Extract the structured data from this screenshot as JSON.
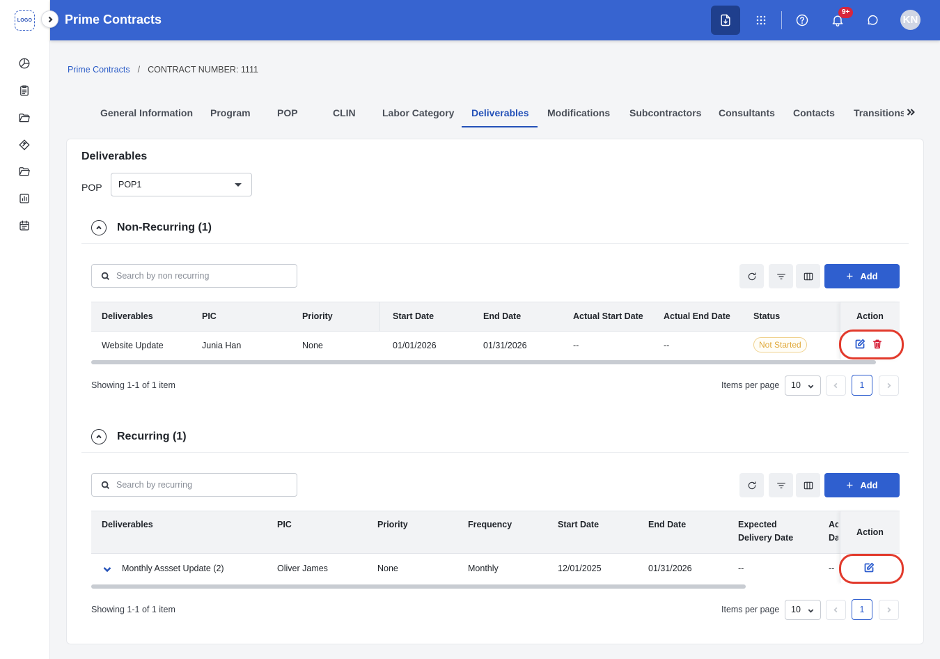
{
  "app": {
    "logo_text": "LOGO",
    "title": "Prime Contracts",
    "notifications_badge": "9+",
    "user_initials": "KN"
  },
  "breadcrumb": {
    "root": "Prime Contracts",
    "separator": "/",
    "current": "CONTRACT NUMBER: 1111"
  },
  "tabs": [
    {
      "label": "General Information"
    },
    {
      "label": "Program"
    },
    {
      "label": "POP"
    },
    {
      "label": "CLIN"
    },
    {
      "label": "Labor Category"
    },
    {
      "label": "Deliverables",
      "active": true
    },
    {
      "label": "Modifications"
    },
    {
      "label": "Subcontractors"
    },
    {
      "label": "Consultants"
    },
    {
      "label": "Contacts"
    },
    {
      "label": "Transitions"
    }
  ],
  "page": {
    "title": "Deliverables",
    "pop_label": "POP",
    "pop_value": "POP1"
  },
  "non_recurring": {
    "title": "Non-Recurring (1)",
    "search_placeholder": "Search by non recurring",
    "add_label": "Add",
    "columns": [
      "Deliverables",
      "PIC",
      "Priority",
      "Start Date",
      "End Date",
      "Actual Start Date",
      "Actual End Date",
      "Status",
      "Action"
    ],
    "rows": [
      {
        "deliverable": "Website Update",
        "pic": "Junia Han",
        "priority": "None",
        "start": "01/01/2026",
        "end": "01/31/2026",
        "actual_start": "--",
        "actual_end": "--",
        "status": "Not Started"
      }
    ],
    "showing": "Showing 1-1 of 1 item",
    "items_per_page_label": "Items per page",
    "items_per_page": "10",
    "page": "1"
  },
  "recurring": {
    "title": "Recurring (1)",
    "search_placeholder": "Search by recurring",
    "add_label": "Add",
    "columns": [
      "Deliverables",
      "PIC",
      "Priority",
      "Frequency",
      "Start Date",
      "End Date",
      "Expected Delivery Date",
      "Ac Da",
      "Action"
    ],
    "rows": [
      {
        "deliverable": "Monthly Assset Update (2)",
        "pic": "Oliver James",
        "priority": "None",
        "frequency": "Monthly",
        "start": "12/01/2025",
        "end": "01/31/2026",
        "expected": "--",
        "actual": "--"
      }
    ],
    "showing": "Showing 1-1 of 1 item",
    "items_per_page_label": "Items per page",
    "items_per_page": "10",
    "page": "1"
  },
  "colors": {
    "topbar": "#3764d0",
    "accent": "#2f5fcf",
    "status_not_started": "#e0a93a",
    "highlight": "#e23a2c",
    "delete": "#d7263d"
  },
  "icons": [
    "chevron-right-icon",
    "download-file-icon",
    "apps-grid-icon",
    "help-icon",
    "bell-icon",
    "chat-icon",
    "pie-chart-icon",
    "clipboard-icon",
    "folder-icon",
    "tag-icon",
    "folder-open-icon",
    "report-icon",
    "calendar-icon",
    "search-icon",
    "refresh-icon",
    "filter-icon",
    "columns-icon",
    "plus-icon",
    "edit-icon",
    "trash-icon",
    "chevron-up-icon",
    "chevron-down-icon",
    "double-chevron-right-icon",
    "chevron-left-icon"
  ]
}
